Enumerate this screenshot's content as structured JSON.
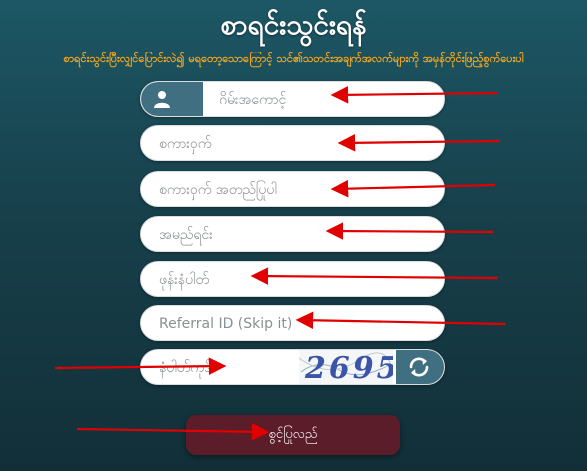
{
  "header": {
    "title": "စာရင်းသွင်းရန်",
    "subtitle": "စာရင်းသွင်းပြီးလျှင်ပြောင်းလဲ၍ မရတော့သောကြောင့် သင်၏သတင်းအချက်အလက်များကို အမှန်တိုင်းဖြည့်စွက်ပေးပါ"
  },
  "form": {
    "username_placeholder": "ဂိမ်းအကောင့်",
    "password_placeholder": "စကားဝှက်",
    "confirm_password_placeholder": "စကားဝှက် အတည်ပြုပါ",
    "name_placeholder": "အမည်ရင်း",
    "phone_placeholder": "ဖုန်းနံပါတ်",
    "referral_placeholder": "Referral ID (Skip it)",
    "captcha_placeholder": "နံပါတ်ကုဒ်",
    "captcha_code": "2695",
    "submit_label": "စွင့်ပြုလည်"
  },
  "icons": {
    "user": "user-icon",
    "refresh": "refresh-icon"
  },
  "colors": {
    "background": "#1b4a56",
    "accent": "#3f6f80",
    "subtitle": "#f2a51e",
    "submit": "#5c1d2a",
    "arrow": "#e00000"
  }
}
